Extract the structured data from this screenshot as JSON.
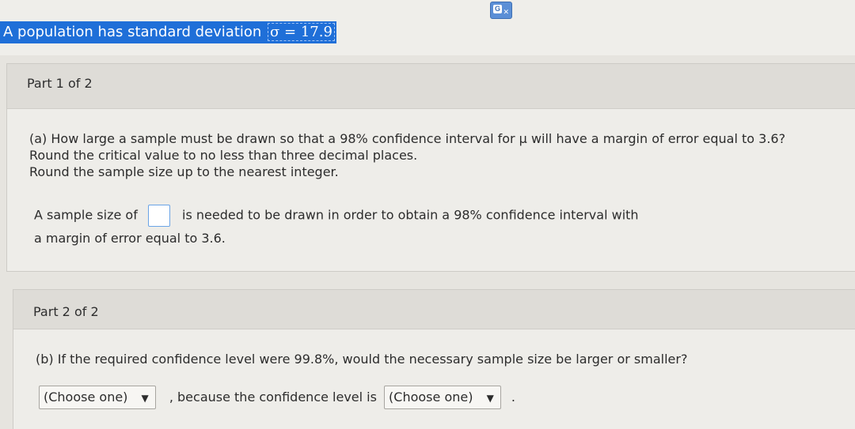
{
  "banner": {
    "text": "A population has standard deviation",
    "math": "σ = 17.9"
  },
  "part1": {
    "label": "Part 1 of 2",
    "question_lines": [
      "(a) How large a sample must be drawn so that a 98% confidence interval for μ will have a margin of error equal to 3.6?",
      "Round the critical value to no less than three decimal places.",
      "Round the sample size up to the nearest integer."
    ],
    "answer_prefix": "A sample size of",
    "answer_value": "",
    "answer_suffix": "is needed to be drawn in order to obtain a 98% confidence interval with",
    "answer_line2": "a margin of error equal to 3.6."
  },
  "part2": {
    "label": "Part 2 of 2",
    "question": "(b) If the required confidence level were 99.8%, would the necessary sample size be larger or smaller?",
    "select1": "(Choose one)",
    "middle_text": ", because the confidence level is",
    "select2": "(Choose one)",
    "end_text": ".",
    "arrow_glyph": "▼"
  },
  "colors": {
    "banner_bg": "#1f6fd8",
    "header_bg": "#dedcd7",
    "panel_bg": "#eeede9",
    "input_border": "#6aa4e6"
  },
  "icons": [
    "translate-icon"
  ]
}
